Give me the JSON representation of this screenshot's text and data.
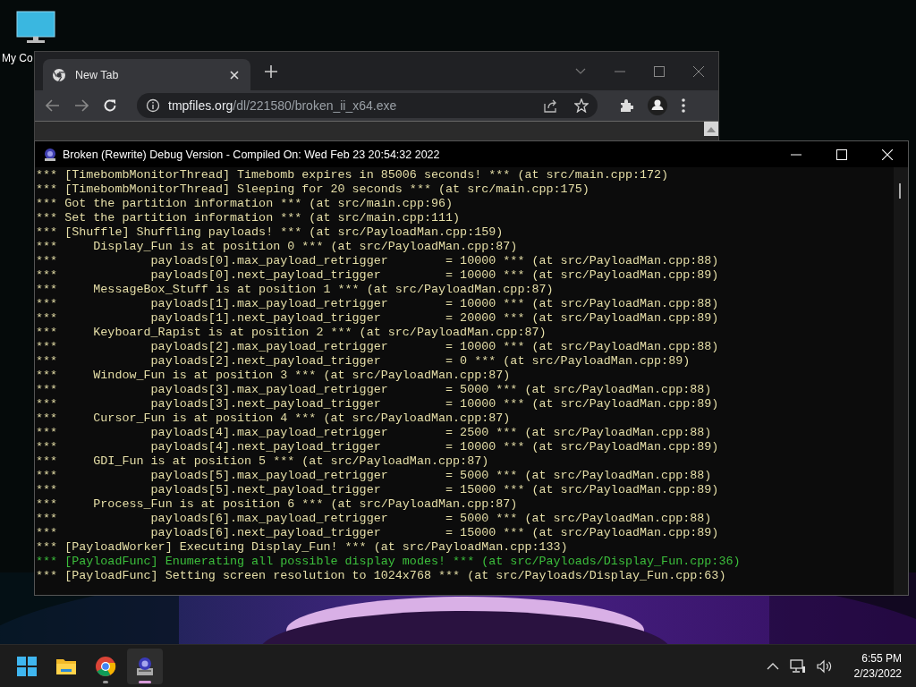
{
  "desktop_icons": [
    {
      "label": "My Co"
    }
  ],
  "browser": {
    "tabs": [
      {
        "title": "New Tab",
        "selected": true
      }
    ],
    "address": "**tmpfiles.org**/dl/221580/broken_ii_x64.exe"
  },
  "console": {
    "title": "Broken (Rewrite) Debug Version - Compiled On: Wed Feb 23 20:54:32 2022",
    "lines": [
      {
        "text": "*** [TimebombMonitorThread] Timebomb expires in 85006 seconds! *** (at src/main.cpp:172)",
        "color": "#e6dfa8"
      },
      {
        "text": "*** [TimebombMonitorThread] Sleeping for 20 seconds *** (at src/main.cpp:175)",
        "color": "#e6dfa8"
      },
      {
        "text": "*** Got the partition information *** (at src/main.cpp:96)",
        "color": "#e6dfa8"
      },
      {
        "text": "*** Set the partition information *** (at src/main.cpp:111)",
        "color": "#e6dfa8"
      },
      {
        "text": "*** [Shuffle] Shuffling payloads! *** (at src/PayloadMan.cpp:159)",
        "color": "#e6dfa8"
      },
      {
        "text": "***     Display_Fun is at position 0 *** (at src/PayloadMan.cpp:87)",
        "color": "#e6dfa8"
      },
      {
        "text": "***             payloads[0].max_payload_retrigger        = 10000 *** (at src/PayloadMan.cpp:88)",
        "color": "#e6dfa8"
      },
      {
        "text": "***             payloads[0].next_payload_trigger         = 10000 *** (at src/PayloadMan.cpp:89)",
        "color": "#e6dfa8"
      },
      {
        "text": "***     MessageBox_Stuff is at position 1 *** (at src/PayloadMan.cpp:87)",
        "color": "#e6dfa8"
      },
      {
        "text": "***             payloads[1].max_payload_retrigger        = 10000 *** (at src/PayloadMan.cpp:88)",
        "color": "#e6dfa8"
      },
      {
        "text": "***             payloads[1].next_payload_trigger         = 20000 *** (at src/PayloadMan.cpp:89)",
        "color": "#e6dfa8"
      },
      {
        "text": "***     Keyboard_Rapist is at position 2 *** (at src/PayloadMan.cpp:87)",
        "color": "#e6dfa8"
      },
      {
        "text": "***             payloads[2].max_payload_retrigger        = 10000 *** (at src/PayloadMan.cpp:88)",
        "color": "#e6dfa8"
      },
      {
        "text": "***             payloads[2].next_payload_trigger         = 0 *** (at src/PayloadMan.cpp:89)",
        "color": "#e6dfa8"
      },
      {
        "text": "***     Window_Fun is at position 3 *** (at src/PayloadMan.cpp:87)",
        "color": "#e6dfa8"
      },
      {
        "text": "***             payloads[3].max_payload_retrigger        = 5000 *** (at src/PayloadMan.cpp:88)",
        "color": "#e6dfa8"
      },
      {
        "text": "***             payloads[3].next_payload_trigger         = 10000 *** (at src/PayloadMan.cpp:89)",
        "color": "#e6dfa8"
      },
      {
        "text": "***     Cursor_Fun is at position 4 *** (at src/PayloadMan.cpp:87)",
        "color": "#e6dfa8"
      },
      {
        "text": "***             payloads[4].max_payload_retrigger        = 2500 *** (at src/PayloadMan.cpp:88)",
        "color": "#e6dfa8"
      },
      {
        "text": "***             payloads[4].next_payload_trigger         = 10000 *** (at src/PayloadMan.cpp:89)",
        "color": "#e6dfa8"
      },
      {
        "text": "***     GDI_Fun is at position 5 *** (at src/PayloadMan.cpp:87)",
        "color": "#e6dfa8"
      },
      {
        "text": "***             payloads[5].max_payload_retrigger        = 5000 *** (at src/PayloadMan.cpp:88)",
        "color": "#e6dfa8"
      },
      {
        "text": "***             payloads[5].next_payload_trigger         = 15000 *** (at src/PayloadMan.cpp:89)",
        "color": "#e6dfa8"
      },
      {
        "text": "***     Process_Fun is at position 6 *** (at src/PayloadMan.cpp:87)",
        "color": "#e6dfa8"
      },
      {
        "text": "***             payloads[6].max_payload_retrigger        = 5000 *** (at src/PayloadMan.cpp:88)",
        "color": "#e6dfa8"
      },
      {
        "text": "***             payloads[6].next_payload_trigger         = 15000 *** (at src/PayloadMan.cpp:89)",
        "color": "#e6dfa8"
      },
      {
        "text": "*** [PayloadWorker] Executing Display_Fun! *** (at src/PayloadMan.cpp:133)",
        "color": "#e6dfa8"
      },
      {
        "text": "*** [PayloadFunc] Enumerating all possible display modes! *** (at src/Payloads/Display_Fun.cpp:36)",
        "color": "#3cbf3c"
      },
      {
        "text": "*** [PayloadFunc] Setting screen resolution to 1024x768 *** (at src/Payloads/Display_Fun.cpp:63)",
        "color": "#e6dfa8"
      }
    ]
  },
  "taskbar": {
    "apps": [
      {
        "kind": "start",
        "running": false,
        "active": false
      },
      {
        "kind": "folder",
        "running": false,
        "active": false
      },
      {
        "kind": "browser",
        "running": true,
        "active": false
      },
      {
        "kind": "console-app",
        "running": true,
        "active": true
      }
    ],
    "clock": {
      "time": "6:55 PM",
      "date": "2/23/2022"
    }
  }
}
